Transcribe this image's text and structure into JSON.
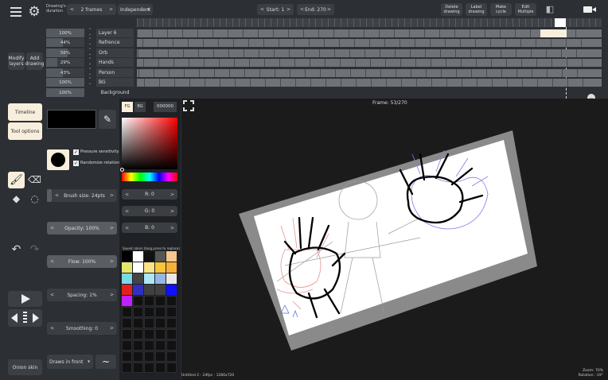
{
  "topbar": {
    "duration_label": "Drawing's duration",
    "duration_value": "2 frames",
    "mode_value": "Independent",
    "start_label": "Start: 1",
    "end_label": "End: 270",
    "buttons": [
      "Delete drawing",
      "Label drawing",
      "Make cycle",
      "Edit Multiple"
    ]
  },
  "left": {
    "modify_layers": "Modify layers",
    "add_drawing": "Add drawing",
    "timeline": "Timeline",
    "tool_options": "Tool options",
    "onion_skin": "Onion skin"
  },
  "layers": [
    {
      "opacity": "100%",
      "name": "Layer 6",
      "fill": 1.0
    },
    {
      "opacity": "44%",
      "name": "Refrence",
      "fill": 0.44
    },
    {
      "opacity": "56%",
      "name": "Orb",
      "fill": 0.56
    },
    {
      "opacity": "29%",
      "name": "Hands",
      "fill": 0.29
    },
    {
      "opacity": "43%",
      "name": "Person",
      "fill": 0.43
    },
    {
      "opacity": "100%",
      "name": "BG",
      "fill": 1.0
    },
    {
      "opacity": "100%",
      "name": "Background",
      "fill": 1.0
    }
  ],
  "tool_options": {
    "pressure": "Pressure sensitivity",
    "randomize": "Randomize rotation",
    "brush_size": "Brush size: 24pts",
    "opacity": "Opacity: 100%",
    "flow": "Flow: 100%",
    "spacing": "Spacing: 1%",
    "smoothing": "Smoothing: 0",
    "draw_mode": "Draws in front"
  },
  "color": {
    "fg": "FG",
    "bg": "BG",
    "hex": "000000",
    "r": "R: 0",
    "g": "G: 0",
    "b": "B: 0",
    "saved_label": "Saved colors (long press to replace)",
    "swatches": [
      "#000000",
      "#ffffff",
      "#111111",
      "#555555",
      "#f6c68e",
      "#e3e66c",
      "#ffffff",
      "#f8e28a",
      "#f7c53b",
      "#f6b13a",
      "#7ad8e8",
      "#444444",
      "#aee6f5",
      "#96b6e8",
      "#e8e8e8",
      "#e02020",
      "#3030c0",
      "#404040",
      "#404040",
      "#1010ff",
      "#c020ff"
    ]
  },
  "canvas": {
    "frame_label": "Frame: 53/270",
    "file_info": "Untitled 2 - 24fps - 1280x720",
    "zoom": "Zoom: 70%",
    "rotation": "Rotation: -19°"
  }
}
